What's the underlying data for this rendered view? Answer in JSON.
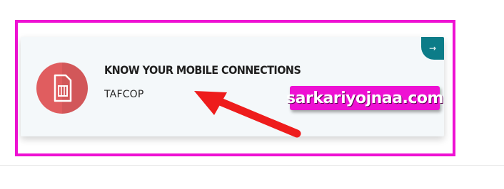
{
  "card": {
    "title": "KNOW YOUR MOBILE CONNECTIONS",
    "subtitle": "TAFCOP",
    "corner_icon": "arrow-right-icon",
    "corner_glyph": "→",
    "main_icon": "sim-card-icon"
  },
  "watermark": {
    "text": "sarkariyojnaa.com"
  },
  "colors": {
    "highlight": "#ee11d3",
    "card_background": "#f4f8fa",
    "icon_circle": "#e05d5f",
    "corner_tab": "#0c7c88",
    "arrow": "#ee1c1c"
  }
}
